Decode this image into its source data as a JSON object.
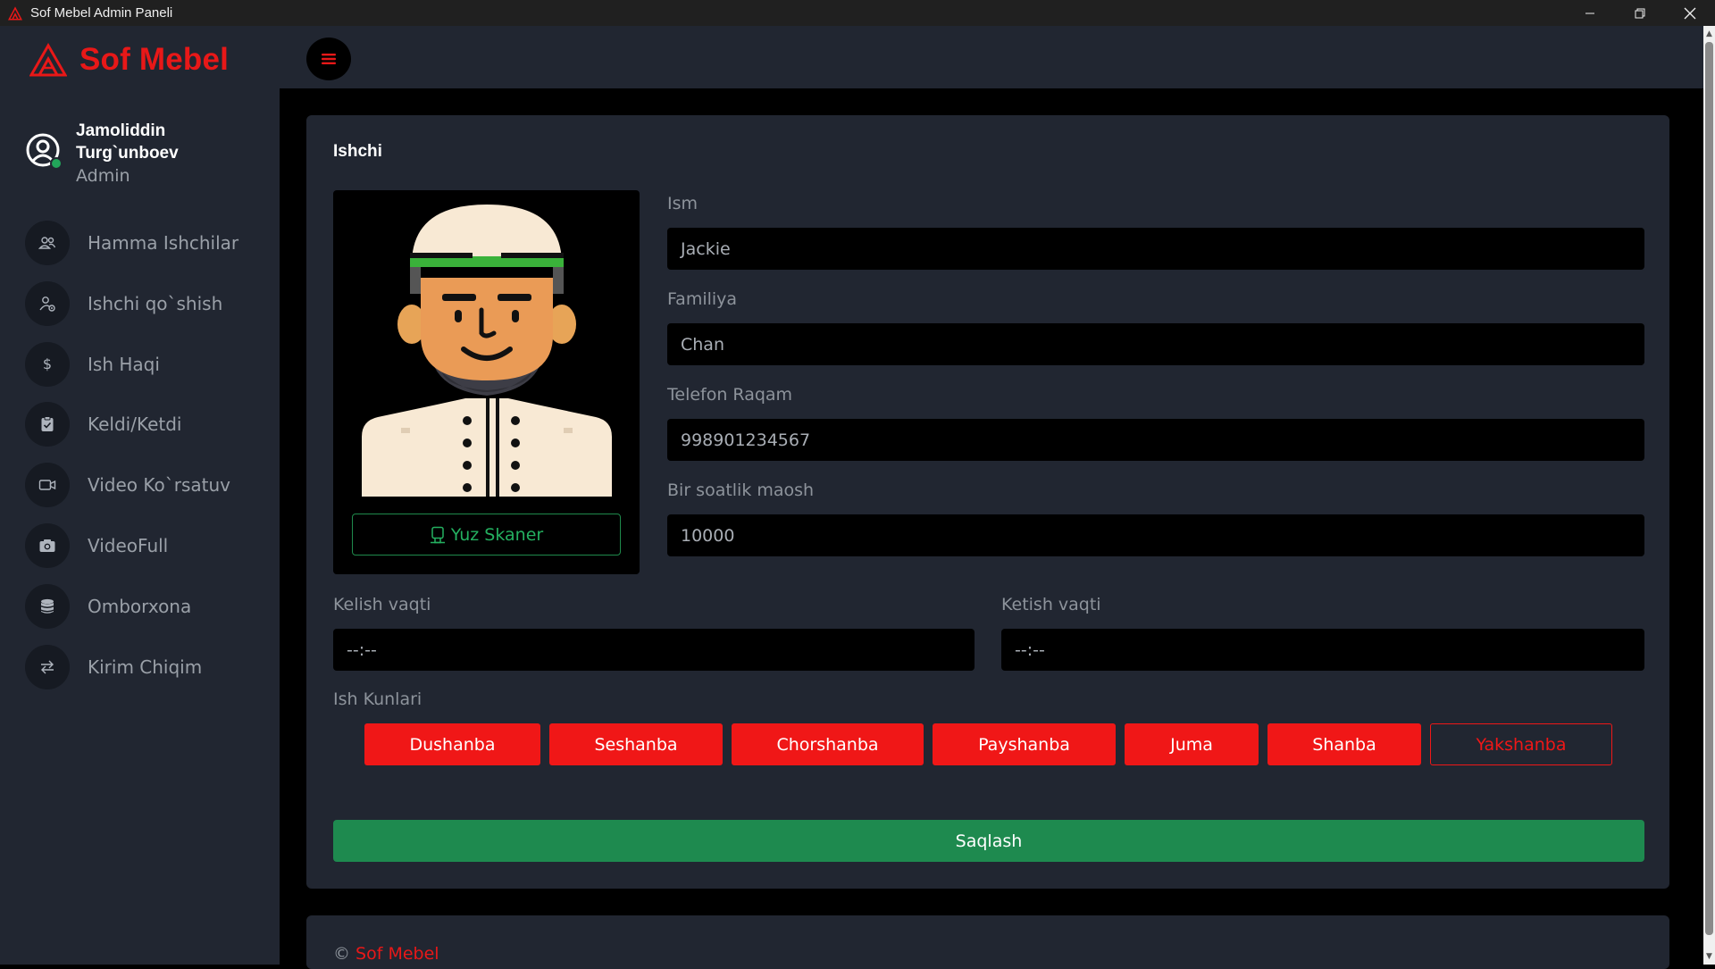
{
  "window": {
    "title": "Sof Mebel Admin Paneli",
    "controls": [
      "minimize",
      "maximize",
      "close"
    ]
  },
  "brand": {
    "name": "Sof Mebel",
    "color": "#e81818"
  },
  "user": {
    "name": "Jamoliddin Turg`unboev",
    "role": "Admin",
    "status": "online"
  },
  "nav": {
    "items": [
      {
        "label": "Hamma Ishchilar",
        "icon": "users-icon"
      },
      {
        "label": "Ishchi qo`shish",
        "icon": "user-add-icon"
      },
      {
        "label": "Ish Haqi",
        "icon": "dollar-icon"
      },
      {
        "label": "Keldi/Ketdi",
        "icon": "clipboard-icon"
      },
      {
        "label": "Video Ko`rsatuv",
        "icon": "video-camera-icon"
      },
      {
        "label": "VideoFull",
        "icon": "camera-icon"
      },
      {
        "label": "Omborxona",
        "icon": "database-icon"
      },
      {
        "label": "Kirim Chiqim",
        "icon": "transfer-arrows-icon"
      }
    ]
  },
  "form": {
    "title": "Ishchi",
    "scan_button": "Yuz Skaner",
    "fields": {
      "first_name": {
        "label": "Ism",
        "value": "Jackie"
      },
      "last_name": {
        "label": "Familiya",
        "value": "Chan"
      },
      "phone": {
        "label": "Telefon Raqam",
        "value": "998901234567"
      },
      "hourly_wage": {
        "label": "Bir soatlik maosh",
        "value": "10000"
      },
      "arrival_time": {
        "label": "Kelish vaqti",
        "value": "--:--"
      },
      "departure_time": {
        "label": "Ketish vaqti",
        "value": "--:--"
      }
    },
    "workdays_label": "Ish Kunlari",
    "days": [
      {
        "label": "Dushanba",
        "selected": true
      },
      {
        "label": "Seshanba",
        "selected": true
      },
      {
        "label": "Chorshanba",
        "selected": true
      },
      {
        "label": "Payshanba",
        "selected": true
      },
      {
        "label": "Juma",
        "selected": true
      },
      {
        "label": "Shanba",
        "selected": true
      },
      {
        "label": "Yakshanba",
        "selected": false
      }
    ],
    "save_button": "Saqlash"
  },
  "footer": {
    "symbol": "©",
    "brand": "Sof Mebel"
  },
  "colors": {
    "accent": "#f01717",
    "success": "#1e8a4f",
    "sidebar": "#212631",
    "background": "#000000"
  }
}
